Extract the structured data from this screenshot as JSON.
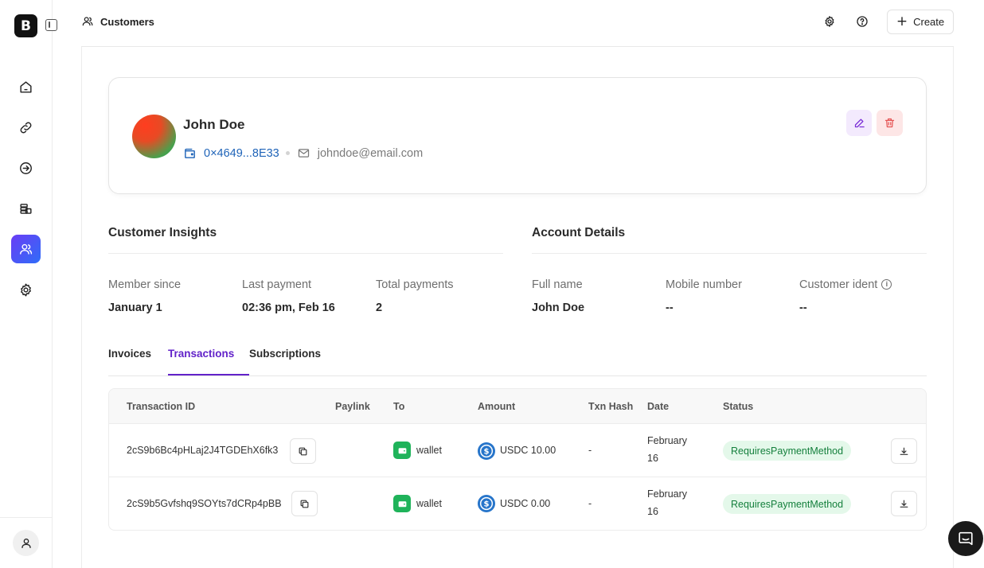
{
  "brand": {
    "logo_letter": "B"
  },
  "topbar": {
    "title": "Customers",
    "create_label": "Create"
  },
  "sidebar": {
    "items": [
      {
        "name": "home"
      },
      {
        "name": "paylinks"
      },
      {
        "name": "payments"
      },
      {
        "name": "ledger"
      },
      {
        "name": "customers",
        "active": true
      },
      {
        "name": "settings"
      }
    ]
  },
  "customer": {
    "name": "John Doe",
    "wallet": "0×4649...8E33",
    "email": "johndoe@email.com"
  },
  "insights": {
    "heading": "Customer Insights",
    "member_since_label": "Member since",
    "member_since_value": "January 1",
    "last_payment_label": "Last payment",
    "last_payment_value": "02:36 pm, Feb 16",
    "total_payments_label": "Total payments",
    "total_payments_value": "2"
  },
  "account": {
    "heading": "Account Details",
    "full_name_label": "Full name",
    "full_name_value": "John Doe",
    "mobile_label": "Mobile number",
    "mobile_value": "--",
    "ident_label": "Customer ident",
    "ident_value": "--"
  },
  "tabs": [
    {
      "label": "Invoices"
    },
    {
      "label": "Transactions",
      "active": true
    },
    {
      "label": "Subscriptions"
    }
  ],
  "table": {
    "columns": [
      "Transaction ID",
      "Paylink",
      "To",
      "Amount",
      "Txn Hash",
      "Date",
      "Status"
    ],
    "rows": [
      {
        "id": "2cS9b6Bc4pHLaj2J4TGDEhX6fk3",
        "paylink": "",
        "to": "wallet",
        "amount": "USDC 10.00",
        "hash": "-",
        "date_line1": "February",
        "date_line2": "16",
        "status": "RequiresPaymentMethod"
      },
      {
        "id": "2cS9b5Gvfshq9SOYts7dCRp4pBB",
        "paylink": "",
        "to": "wallet",
        "amount": "USDC 0.00",
        "hash": "-",
        "date_line1": "February",
        "date_line2": "16",
        "status": "RequiresPaymentMethod"
      }
    ]
  },
  "colors": {
    "accent": "#6222c9",
    "active_nav_gradient_start": "#6a3df5",
    "active_nav_gradient_end": "#2f6df8",
    "wallet_link": "#1e63b8",
    "status_bg": "#e4f8ea",
    "status_text": "#15803d",
    "usdc": "#2775ca",
    "wallet_badge": "#1fb35a"
  }
}
